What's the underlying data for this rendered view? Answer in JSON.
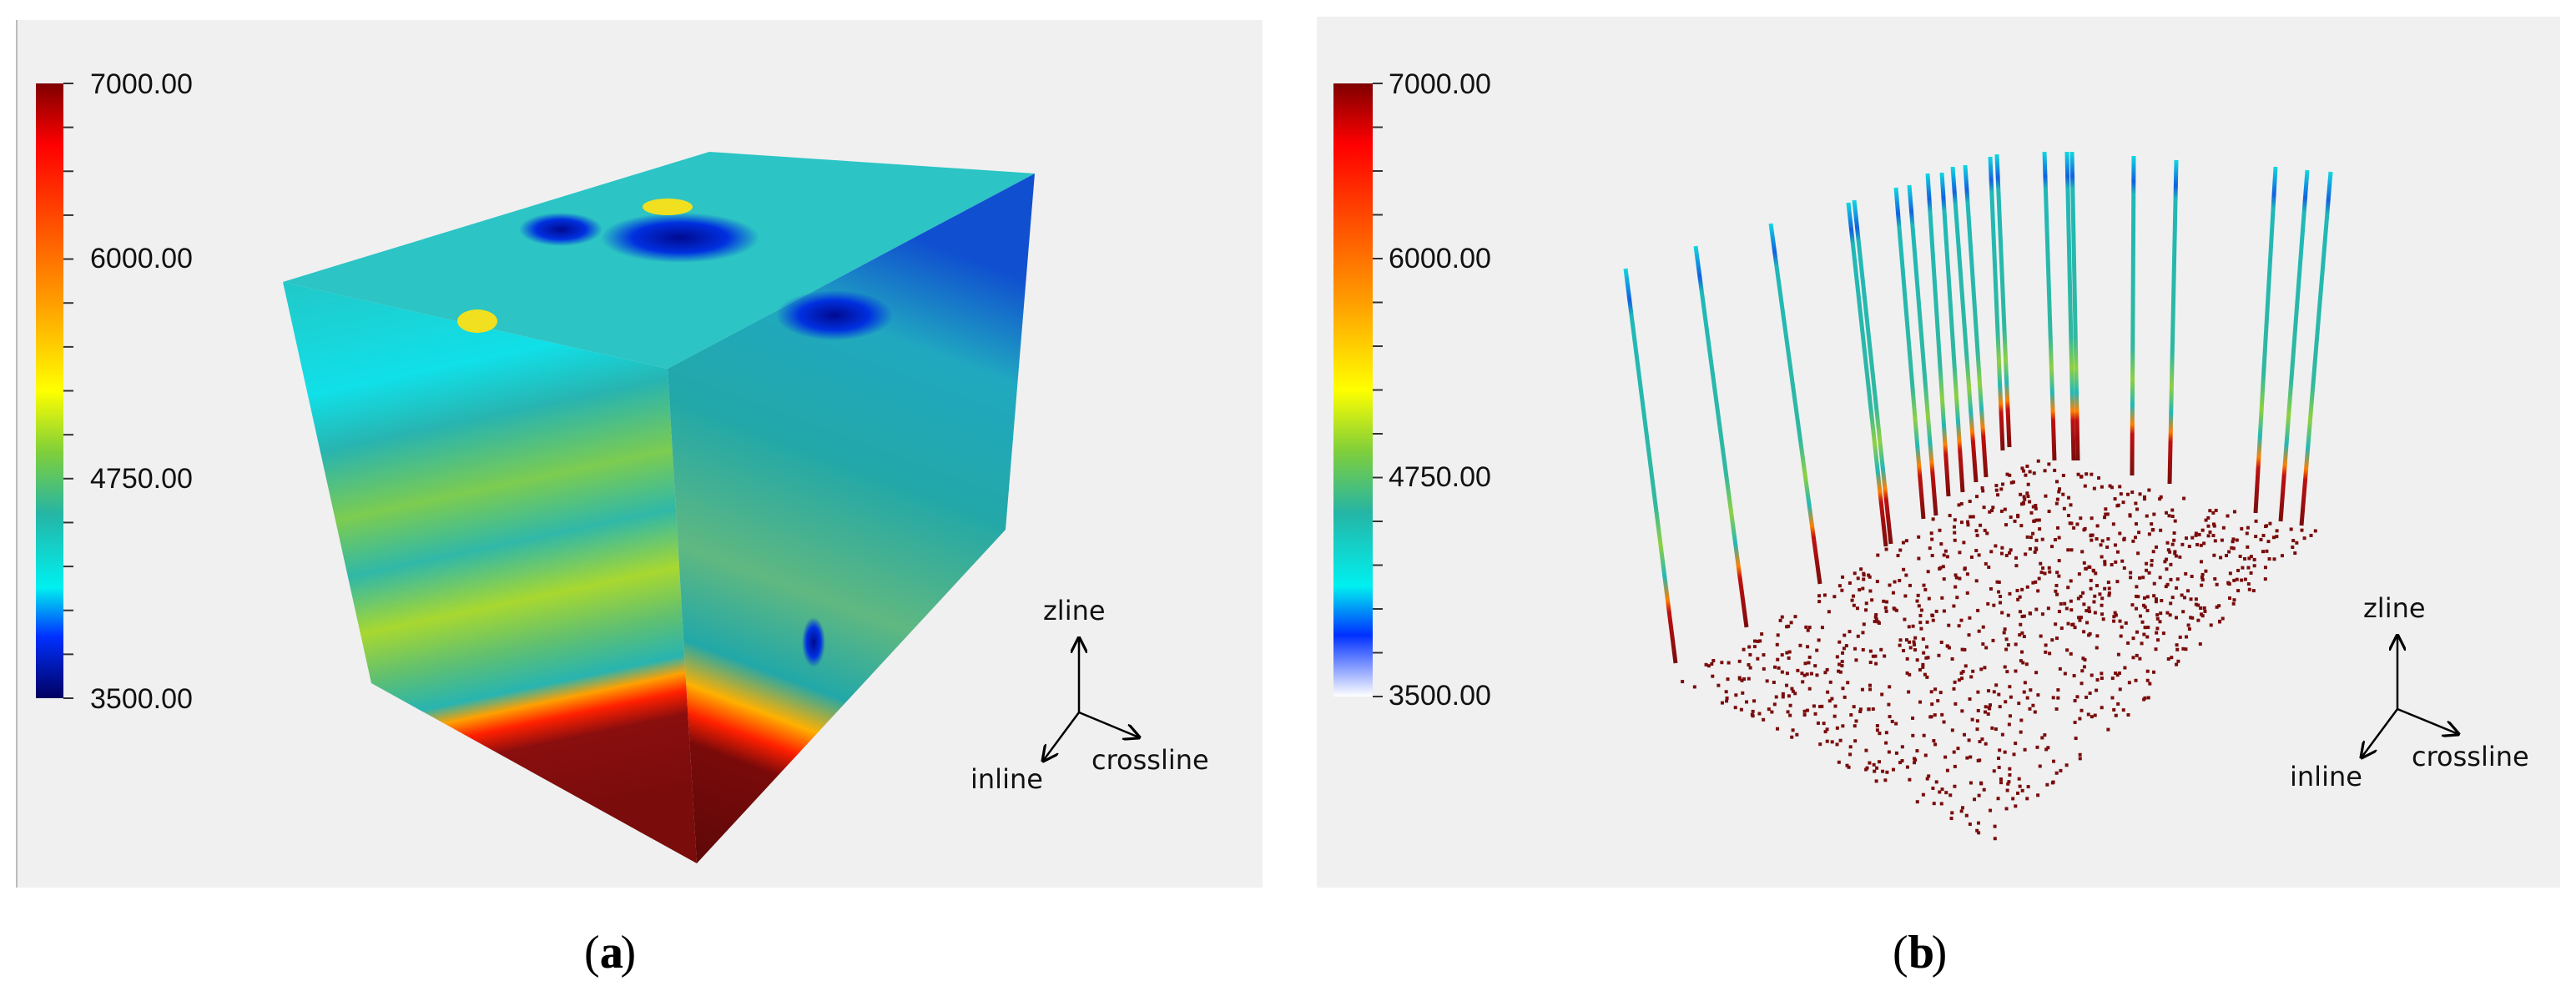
{
  "panels": [
    {
      "id": "a",
      "caption_letter": "a",
      "caption": "(a)",
      "colorbar": {
        "max": "7000.00",
        "mid_high": "6000.00",
        "mid": "4750.00",
        "min": "3500.00"
      },
      "axes": {
        "z": "zline",
        "x": "crossline",
        "y": "inline"
      }
    },
    {
      "id": "b",
      "caption_letter": "b",
      "caption": "(b)",
      "colorbar": {
        "max": "7000.00",
        "mid_high": "6000.00",
        "mid": "4750.00",
        "min": "3500.00"
      },
      "axes": {
        "z": "zline",
        "x": "crossline",
        "y": "inline"
      }
    }
  ],
  "colors": {
    "panel_bg": "#f0f0f0",
    "dark_red": "#7a0c0c",
    "teal": "#22b5b0"
  }
}
